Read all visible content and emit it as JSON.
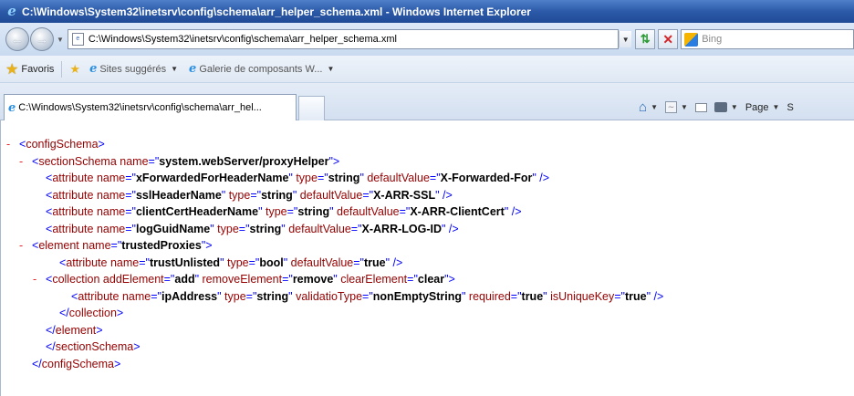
{
  "window": {
    "title": "C:\\Windows\\System32\\inetsrv\\config\\schema\\arr_helper_schema.xml - Windows Internet Explorer"
  },
  "address_bar": {
    "url": "C:\\Windows\\System32\\inetsrv\\config\\schema\\arr_helper_schema.xml",
    "search_placeholder": "Bing"
  },
  "favorites_bar": {
    "favorites_label": "Favoris",
    "items": [
      {
        "label": "Sites suggérés"
      },
      {
        "label": "Galerie de composants W..."
      }
    ]
  },
  "tab": {
    "label": "C:\\Windows\\System32\\inetsrv\\config\\schema\\arr_hel..."
  },
  "command_bar": {
    "page_label": "Page",
    "trailing": "S"
  },
  "xml": {
    "lines": [
      {
        "indent": 0,
        "minus": "-",
        "parts": [
          [
            "b",
            "<"
          ],
          [
            "t",
            "configSchema"
          ],
          [
            "b",
            ">"
          ]
        ]
      },
      {
        "indent": 1,
        "minus": "-",
        "parts": [
          [
            "b",
            "<"
          ],
          [
            "t",
            "sectionSchema"
          ],
          [
            "a",
            " name"
          ],
          [
            "b",
            "=\""
          ],
          [
            "v",
            "system.webServer/proxyHelper"
          ],
          [
            "b",
            "\">"
          ]
        ]
      },
      {
        "indent": 2,
        "minus": "",
        "parts": [
          [
            "b",
            "<"
          ],
          [
            "t",
            "attribute"
          ],
          [
            "a",
            " name"
          ],
          [
            "b",
            "=\""
          ],
          [
            "v",
            "xForwardedForHeaderName"
          ],
          [
            "b",
            "\""
          ],
          [
            "a",
            " type"
          ],
          [
            "b",
            "=\""
          ],
          [
            "v",
            "string"
          ],
          [
            "b",
            "\""
          ],
          [
            "a",
            " defaultValue"
          ],
          [
            "b",
            "=\""
          ],
          [
            "v",
            "X-Forwarded-For"
          ],
          [
            "b",
            "\" />"
          ]
        ]
      },
      {
        "indent": 2,
        "minus": "",
        "parts": [
          [
            "b",
            "<"
          ],
          [
            "t",
            "attribute"
          ],
          [
            "a",
            " name"
          ],
          [
            "b",
            "=\""
          ],
          [
            "v",
            "sslHeaderName"
          ],
          [
            "b",
            "\""
          ],
          [
            "a",
            " type"
          ],
          [
            "b",
            "=\""
          ],
          [
            "v",
            "string"
          ],
          [
            "b",
            "\""
          ],
          [
            "a",
            " defaultValue"
          ],
          [
            "b",
            "=\""
          ],
          [
            "v",
            "X-ARR-SSL"
          ],
          [
            "b",
            "\" />"
          ]
        ]
      },
      {
        "indent": 2,
        "minus": "",
        "parts": [
          [
            "b",
            "<"
          ],
          [
            "t",
            "attribute"
          ],
          [
            "a",
            " name"
          ],
          [
            "b",
            "=\""
          ],
          [
            "v",
            "clientCertHeaderName"
          ],
          [
            "b",
            "\""
          ],
          [
            "a",
            " type"
          ],
          [
            "b",
            "=\""
          ],
          [
            "v",
            "string"
          ],
          [
            "b",
            "\""
          ],
          [
            "a",
            " defaultValue"
          ],
          [
            "b",
            "=\""
          ],
          [
            "v",
            "X-ARR-ClientCert"
          ],
          [
            "b",
            "\" />"
          ]
        ]
      },
      {
        "indent": 2,
        "minus": "",
        "parts": [
          [
            "b",
            "<"
          ],
          [
            "t",
            "attribute"
          ],
          [
            "a",
            " name"
          ],
          [
            "b",
            "=\""
          ],
          [
            "v",
            "logGuidName"
          ],
          [
            "b",
            "\""
          ],
          [
            "a",
            " type"
          ],
          [
            "b",
            "=\""
          ],
          [
            "v",
            "string"
          ],
          [
            "b",
            "\""
          ],
          [
            "a",
            " defaultValue"
          ],
          [
            "b",
            "=\""
          ],
          [
            "v",
            "X-ARR-LOG-ID"
          ],
          [
            "b",
            "\" />"
          ]
        ]
      },
      {
        "indent": 1,
        "minus": "-",
        "parts": [
          [
            "b",
            "<"
          ],
          [
            "t",
            "element"
          ],
          [
            "a",
            " name"
          ],
          [
            "b",
            "=\""
          ],
          [
            "v",
            "trustedProxies"
          ],
          [
            "b",
            "\">"
          ]
        ]
      },
      {
        "indent": 3,
        "minus": "",
        "parts": [
          [
            "b",
            "<"
          ],
          [
            "t",
            "attribute"
          ],
          [
            "a",
            " name"
          ],
          [
            "b",
            "=\""
          ],
          [
            "v",
            "trustUnlisted"
          ],
          [
            "b",
            "\""
          ],
          [
            "a",
            " type"
          ],
          [
            "b",
            "=\""
          ],
          [
            "v",
            "bool"
          ],
          [
            "b",
            "\""
          ],
          [
            "a",
            " defaultValue"
          ],
          [
            "b",
            "=\""
          ],
          [
            "v",
            "true"
          ],
          [
            "b",
            "\" />"
          ]
        ]
      },
      {
        "indent": 2,
        "minus": "-",
        "parts": [
          [
            "b",
            "<"
          ],
          [
            "t",
            "collection"
          ],
          [
            "a",
            " addElement"
          ],
          [
            "b",
            "=\""
          ],
          [
            "v",
            "add"
          ],
          [
            "b",
            "\""
          ],
          [
            "a",
            " removeElement"
          ],
          [
            "b",
            "=\""
          ],
          [
            "v",
            "remove"
          ],
          [
            "b",
            "\""
          ],
          [
            "a",
            " clearElement"
          ],
          [
            "b",
            "=\""
          ],
          [
            "v",
            "clear"
          ],
          [
            "b",
            "\">"
          ]
        ]
      },
      {
        "indent": 4,
        "minus": "",
        "parts": [
          [
            "b",
            "<"
          ],
          [
            "t",
            "attribute"
          ],
          [
            "a",
            " name"
          ],
          [
            "b",
            "=\""
          ],
          [
            "v",
            "ipAddress"
          ],
          [
            "b",
            "\""
          ],
          [
            "a",
            " type"
          ],
          [
            "b",
            "=\""
          ],
          [
            "v",
            "string"
          ],
          [
            "b",
            "\""
          ],
          [
            "a",
            " validatioType"
          ],
          [
            "b",
            "=\""
          ],
          [
            "v",
            "nonEmptyString"
          ],
          [
            "b",
            "\""
          ],
          [
            "a",
            " required"
          ],
          [
            "b",
            "=\""
          ],
          [
            "v",
            "true"
          ],
          [
            "b",
            "\""
          ],
          [
            "a",
            " isUniqueKey"
          ],
          [
            "b",
            "=\""
          ],
          [
            "v",
            "true"
          ],
          [
            "b",
            "\" />"
          ]
        ]
      },
      {
        "indent": 3,
        "minus": "",
        "parts": [
          [
            "b",
            "</"
          ],
          [
            "t",
            "collection"
          ],
          [
            "b",
            ">"
          ]
        ]
      },
      {
        "indent": 2,
        "minus": "",
        "parts": [
          [
            "b",
            "</"
          ],
          [
            "t",
            "element"
          ],
          [
            "b",
            ">"
          ]
        ]
      },
      {
        "indent": 2,
        "minus": "",
        "parts": [
          [
            "b",
            "</"
          ],
          [
            "t",
            "sectionSchema"
          ],
          [
            "b",
            ">"
          ]
        ]
      },
      {
        "indent": 1,
        "minus": "",
        "parts": [
          [
            "b",
            "</"
          ],
          [
            "t",
            "configSchema"
          ],
          [
            "b",
            ">"
          ]
        ]
      }
    ]
  },
  "colors": {
    "tag": "#960000",
    "bracket": "#0000ff",
    "minus": "#e8242c",
    "value": "#000000"
  }
}
